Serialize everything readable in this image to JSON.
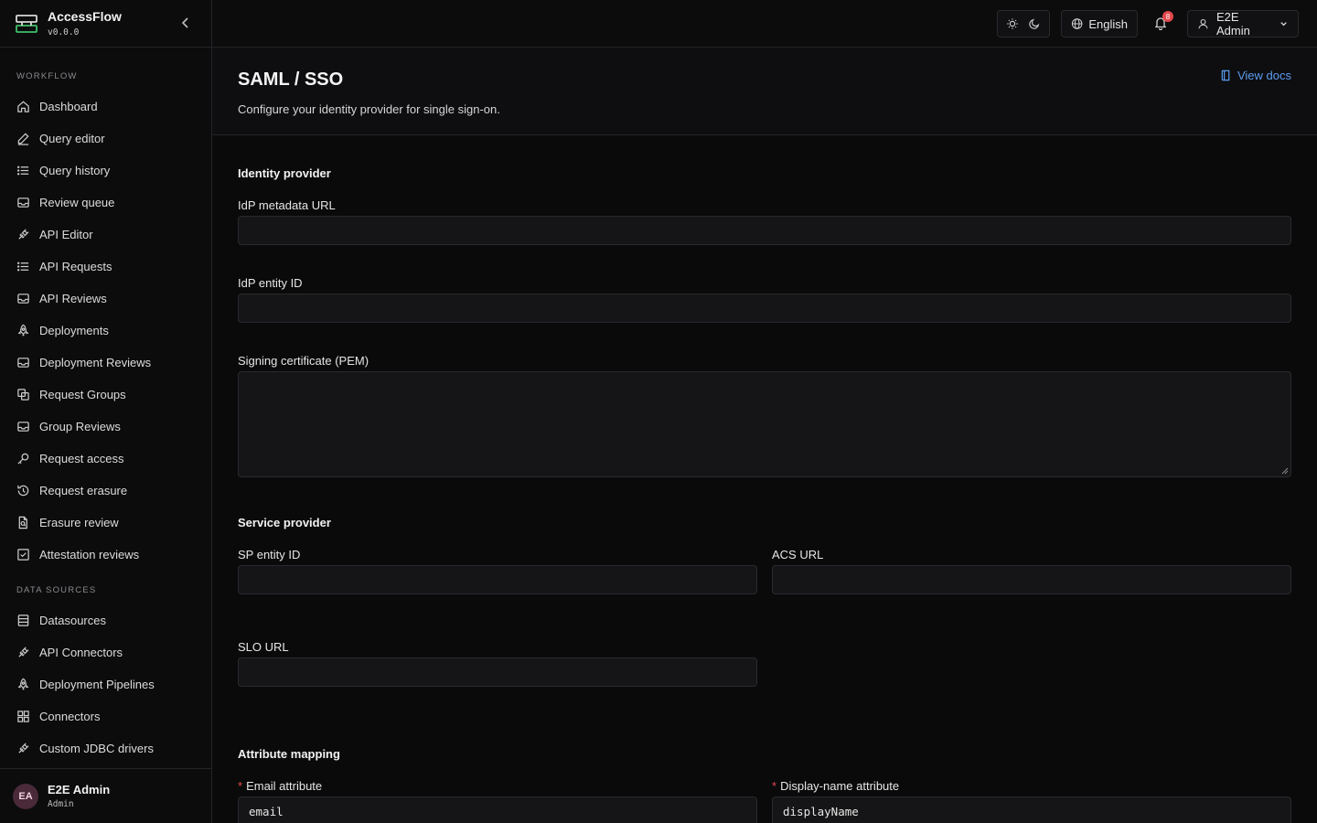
{
  "brand": {
    "title": "AccessFlow",
    "version": "v0.0.0"
  },
  "sidebar": {
    "sections": [
      {
        "label": "WORKFLOW",
        "items": [
          {
            "label": "Dashboard",
            "icon": "home-icon"
          },
          {
            "label": "Query editor",
            "icon": "pencil-icon"
          },
          {
            "label": "Query history",
            "icon": "list-icon"
          },
          {
            "label": "Review queue",
            "icon": "inbox-icon"
          },
          {
            "label": "API Editor",
            "icon": "plug-icon"
          },
          {
            "label": "API Requests",
            "icon": "list-icon"
          },
          {
            "label": "API Reviews",
            "icon": "inbox-icon"
          },
          {
            "label": "Deployments",
            "icon": "rocket-icon"
          },
          {
            "label": "Deployment Reviews",
            "icon": "inbox-icon"
          },
          {
            "label": "Request Groups",
            "icon": "copy-icon"
          },
          {
            "label": "Group Reviews",
            "icon": "inbox-icon"
          },
          {
            "label": "Request access",
            "icon": "key-icon"
          },
          {
            "label": "Request erasure",
            "icon": "history-icon"
          },
          {
            "label": "Erasure review",
            "icon": "file-search-icon"
          },
          {
            "label": "Attestation reviews",
            "icon": "check-square-icon"
          }
        ]
      },
      {
        "label": "DATA SOURCES",
        "items": [
          {
            "label": "Datasources",
            "icon": "database-icon"
          },
          {
            "label": "API Connectors",
            "icon": "plug-icon"
          },
          {
            "label": "Deployment Pipelines",
            "icon": "rocket-icon"
          },
          {
            "label": "Connectors",
            "icon": "grid-icon"
          },
          {
            "label": "Custom JDBC drivers",
            "icon": "plug-icon"
          }
        ]
      }
    ]
  },
  "user": {
    "initials": "EA",
    "name": "E2E Admin",
    "role": "Admin"
  },
  "header": {
    "language": "English",
    "notifications": "8",
    "user_name": "E2E Admin"
  },
  "page": {
    "title": "SAML / SSO",
    "subtitle": "Configure your identity provider for single sign-on.",
    "docs_link": "View docs"
  },
  "form": {
    "idp_section": "Identity provider",
    "idp_metadata_url": {
      "label": "IdP metadata URL",
      "value": ""
    },
    "idp_entity_id": {
      "label": "IdP entity ID",
      "value": ""
    },
    "signing_cert": {
      "label": "Signing certificate (PEM)",
      "value": ""
    },
    "sp_section": "Service provider",
    "sp_entity_id": {
      "label": "SP entity ID",
      "value": ""
    },
    "acs_url": {
      "label": "ACS URL",
      "value": ""
    },
    "slo_url": {
      "label": "SLO URL",
      "value": ""
    },
    "attr_section": "Attribute mapping",
    "email_attr": {
      "label": "Email attribute",
      "value": "email",
      "required": "*"
    },
    "display_name_attr": {
      "label": "Display-name attribute",
      "value": "displayName",
      "required": "*"
    }
  }
}
